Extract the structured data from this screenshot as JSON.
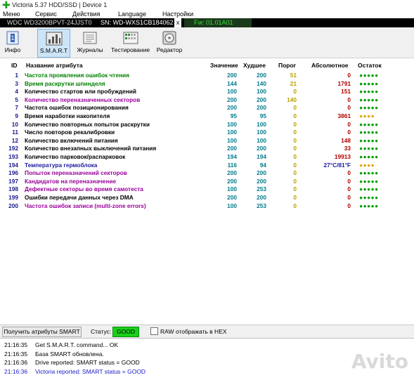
{
  "window": {
    "title": "Victoria 5.37 HDD/SSD | Device 1"
  },
  "menu": [
    "Меню",
    "Сервис",
    "Действия",
    "Language",
    "Настройки"
  ],
  "drive": {
    "model": "WDC WD3200BPVT-24JJST0",
    "serial": "SN: WD-WXS1CB184062",
    "close": "x",
    "firmware": "Fw: 01.01A01"
  },
  "toolbar": [
    {
      "label": "Инфо",
      "icon": "info-icon"
    },
    {
      "label": "S.M.A.R.T",
      "icon": "smart-icon"
    },
    {
      "label": "Журналы",
      "icon": "logs-icon"
    },
    {
      "label": "Тестирование",
      "icon": "testing-icon"
    },
    {
      "label": "Редактор",
      "icon": "editor-icon"
    }
  ],
  "table": {
    "headers": {
      "id": "ID",
      "name": "Название атрибута",
      "value": "Значение",
      "worst": "Худшее",
      "threshold": "Порог",
      "raw": "Абсолютное",
      "remaining": "Остаток"
    },
    "rows": [
      {
        "id": "1",
        "name": "Частота проявления ошибок чтения",
        "value": "200",
        "worst": "200",
        "threshold": "51",
        "raw": "0",
        "remaining": "●●●●●",
        "name_color": "#008000",
        "rem_color": "#00a000"
      },
      {
        "id": "3",
        "name": "Время раскрутки шпинделя",
        "value": "144",
        "worst": "140",
        "threshold": "21",
        "raw": "1791",
        "remaining": "●●●●●",
        "name_color": "#008000",
        "rem_color": "#00a000"
      },
      {
        "id": "4",
        "name": "Количество стартов или пробуждений",
        "value": "100",
        "worst": "100",
        "threshold": "0",
        "raw": "151",
        "remaining": "●●●●●",
        "name_color": "#000000",
        "rem_color": "#00a000"
      },
      {
        "id": "5",
        "name": "Количество переназначенных секторов",
        "value": "200",
        "worst": "200",
        "threshold": "140",
        "raw": "0",
        "remaining": "●●●●●",
        "name_color": "#9b009b",
        "rem_color": "#00a000"
      },
      {
        "id": "7",
        "name": "Частота ошибок позиционирования",
        "value": "200",
        "worst": "200",
        "threshold": "0",
        "raw": "0",
        "remaining": "●●●●●",
        "name_color": "#000000",
        "rem_color": "#00a000"
      },
      {
        "id": "9",
        "name": "Время наработки накопителя",
        "value": "95",
        "worst": "95",
        "threshold": "0",
        "raw": "3861",
        "remaining": "●●●●",
        "name_color": "#000000",
        "rem_color": "#e0a800"
      },
      {
        "id": "10",
        "name": "Количество повторных попыток раскрутки",
        "value": "100",
        "worst": "100",
        "threshold": "0",
        "raw": "0",
        "remaining": "●●●●●",
        "name_color": "#000000",
        "rem_color": "#00a000"
      },
      {
        "id": "11",
        "name": "Число повторов рекалибровки",
        "value": "100",
        "worst": "100",
        "threshold": "0",
        "raw": "0",
        "remaining": "●●●●●",
        "name_color": "#000000",
        "rem_color": "#00a000"
      },
      {
        "id": "12",
        "name": "Количество включений питания",
        "value": "100",
        "worst": "100",
        "threshold": "0",
        "raw": "148",
        "remaining": "●●●●●",
        "name_color": "#000000",
        "rem_color": "#00a000"
      },
      {
        "id": "192",
        "name": "Количество внезапных выключений питания",
        "value": "200",
        "worst": "200",
        "threshold": "0",
        "raw": "33",
        "remaining": "●●●●●",
        "name_color": "#000000",
        "rem_color": "#00a000"
      },
      {
        "id": "193",
        "name": "Количество парковок/распарковок",
        "value": "194",
        "worst": "194",
        "threshold": "0",
        "raw": "19913",
        "remaining": "●●●●●",
        "name_color": "#000000",
        "rem_color": "#00a000"
      },
      {
        "id": "194",
        "name": "Температура гермоблока",
        "value": "116",
        "worst": "94",
        "threshold": "0",
        "raw": "27°C/81°F",
        "remaining": "●●●●",
        "name_color": "#1a1aa0",
        "rem_color": "#e0a800",
        "raw_color": "#1a1aa0"
      },
      {
        "id": "196",
        "name": "Попыток переназначений секторов",
        "value": "200",
        "worst": "200",
        "threshold": "0",
        "raw": "0",
        "remaining": "●●●●●",
        "name_color": "#9b009b",
        "rem_color": "#00a000"
      },
      {
        "id": "197",
        "name": "Кандидатов на переназначение",
        "value": "200",
        "worst": "200",
        "threshold": "0",
        "raw": "0",
        "remaining": "●●●●●",
        "name_color": "#9b009b",
        "rem_color": "#00a000"
      },
      {
        "id": "198",
        "name": "Дефектные секторы во время самотеста",
        "value": "100",
        "worst": "253",
        "threshold": "0",
        "raw": "0",
        "remaining": "●●●●●",
        "name_color": "#9b009b",
        "rem_color": "#00a000"
      },
      {
        "id": "199",
        "name": "Ошибки передачи данных через DMA",
        "value": "200",
        "worst": "200",
        "threshold": "0",
        "raw": "0",
        "remaining": "●●●●●",
        "name_color": "#000000",
        "rem_color": "#00a000"
      },
      {
        "id": "200",
        "name": "Частота ошибок записи (multi-zone errors)",
        "value": "100",
        "worst": "253",
        "threshold": "0",
        "raw": "0",
        "remaining": "●●●●●",
        "name_color": "#9b009b",
        "rem_color": "#00a000"
      }
    ]
  },
  "status_bar": {
    "get_smart_button": "Получить атрибуты SMART",
    "status_label": "Статус:",
    "status_value": "GOOD",
    "raw_checkbox_label": "RAW отображать в HEX",
    "raw_checked": false
  },
  "log": [
    {
      "time": "21:16:35",
      "text": "Get S.M.A.R.T. command... OK",
      "color": "#000000"
    },
    {
      "time": "21:16:35",
      "text": "База SMART обновлена.",
      "color": "#000000"
    },
    {
      "time": "21:16:36",
      "text": "Drive reported: SMART status = GOOD",
      "color": "#000000"
    },
    {
      "time": "21:16:36",
      "text": "Victoria reported: SMART status = GOOD",
      "color": "#1a1ac8"
    }
  ],
  "watermark": "Avito"
}
